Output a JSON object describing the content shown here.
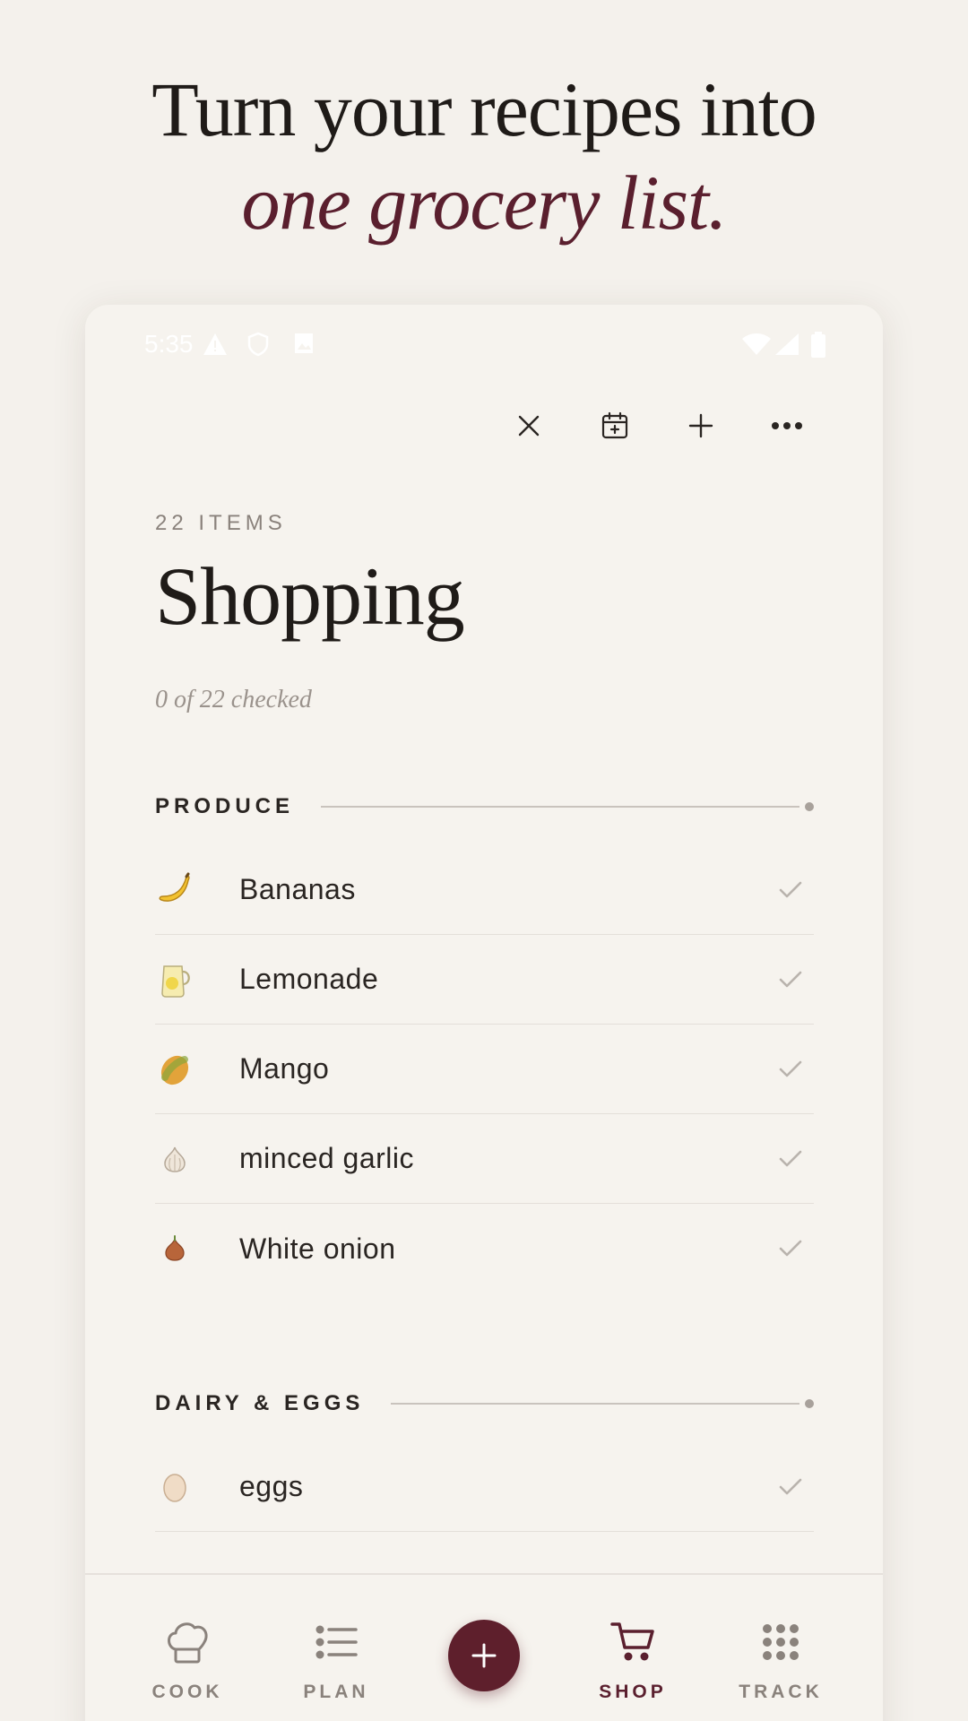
{
  "headline": {
    "line1": "Turn your recipes into",
    "line2": "one grocery list."
  },
  "status_bar": {
    "time": "5:35"
  },
  "toolbar": {
    "close_icon": "close-icon",
    "calendar_icon": "calendar-add-icon",
    "add_icon": "plus-icon",
    "more_icon": "more-horizontal-icon"
  },
  "list": {
    "count_label": "22 ITEMS",
    "title": "Shopping",
    "progress_text": "0 of 22 checked",
    "checked": 0,
    "total": 22
  },
  "sections": [
    {
      "label": "PRODUCE",
      "items": [
        {
          "name": "Bananas",
          "icon": "banana"
        },
        {
          "name": "Lemonade",
          "icon": "lemonade-pitcher"
        },
        {
          "name": "Mango",
          "icon": "mango"
        },
        {
          "name": "minced garlic",
          "icon": "garlic"
        },
        {
          "name": "White onion",
          "icon": "onion"
        }
      ]
    },
    {
      "label": "DAIRY & EGGS",
      "items": [
        {
          "name": "eggs",
          "icon": "egg"
        }
      ]
    }
  ],
  "nav": {
    "items": [
      {
        "label": "COOK",
        "icon": "chef-hat-icon"
      },
      {
        "label": "PLAN",
        "icon": "list-icon"
      },
      {
        "label": "SHOP",
        "icon": "cart-icon",
        "active": true
      },
      {
        "label": "TRACK",
        "icon": "grid-dots-icon"
      }
    ],
    "fab_icon": "plus-icon"
  },
  "colors": {
    "accent": "#5a1f2e",
    "background": "#f4f1ec",
    "muted": "#8a827c"
  }
}
